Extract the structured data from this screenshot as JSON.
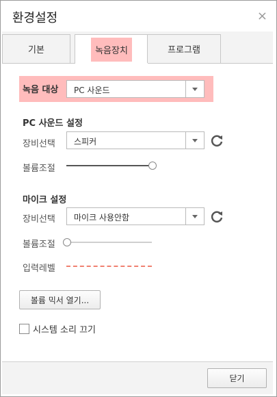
{
  "window": {
    "title": "환경설정",
    "close_glyph": "×"
  },
  "tabs": [
    {
      "label": "기본",
      "active": false
    },
    {
      "label": "녹음장치",
      "active": true
    },
    {
      "label": "프로그램",
      "active": false
    }
  ],
  "recording_target": {
    "label": "녹음 대상",
    "value": "PC 사운드"
  },
  "pc_sound": {
    "title": "PC 사운드 설정",
    "device_label": "장비선택",
    "device_value": "스피커",
    "volume_label": "볼륨조절",
    "volume": 1.0
  },
  "mic": {
    "title": "마이크 설정",
    "device_label": "장비선택",
    "device_value": "마이크 사용안함",
    "volume_label": "볼륨조절",
    "volume": 0.0,
    "input_level_label": "입력레벨"
  },
  "mixer_button": "볼륨 믹서 열기...",
  "mute_system": {
    "label": "시스템 소리 끄기",
    "checked": false
  },
  "close_button": "닫기",
  "colors": {
    "highlight": "#ffbcbc",
    "level": "#f08070",
    "refresh": "#555555"
  },
  "icons": {
    "refresh": "refresh-icon",
    "dropdown": "chevron-down-icon",
    "close": "close-icon"
  }
}
